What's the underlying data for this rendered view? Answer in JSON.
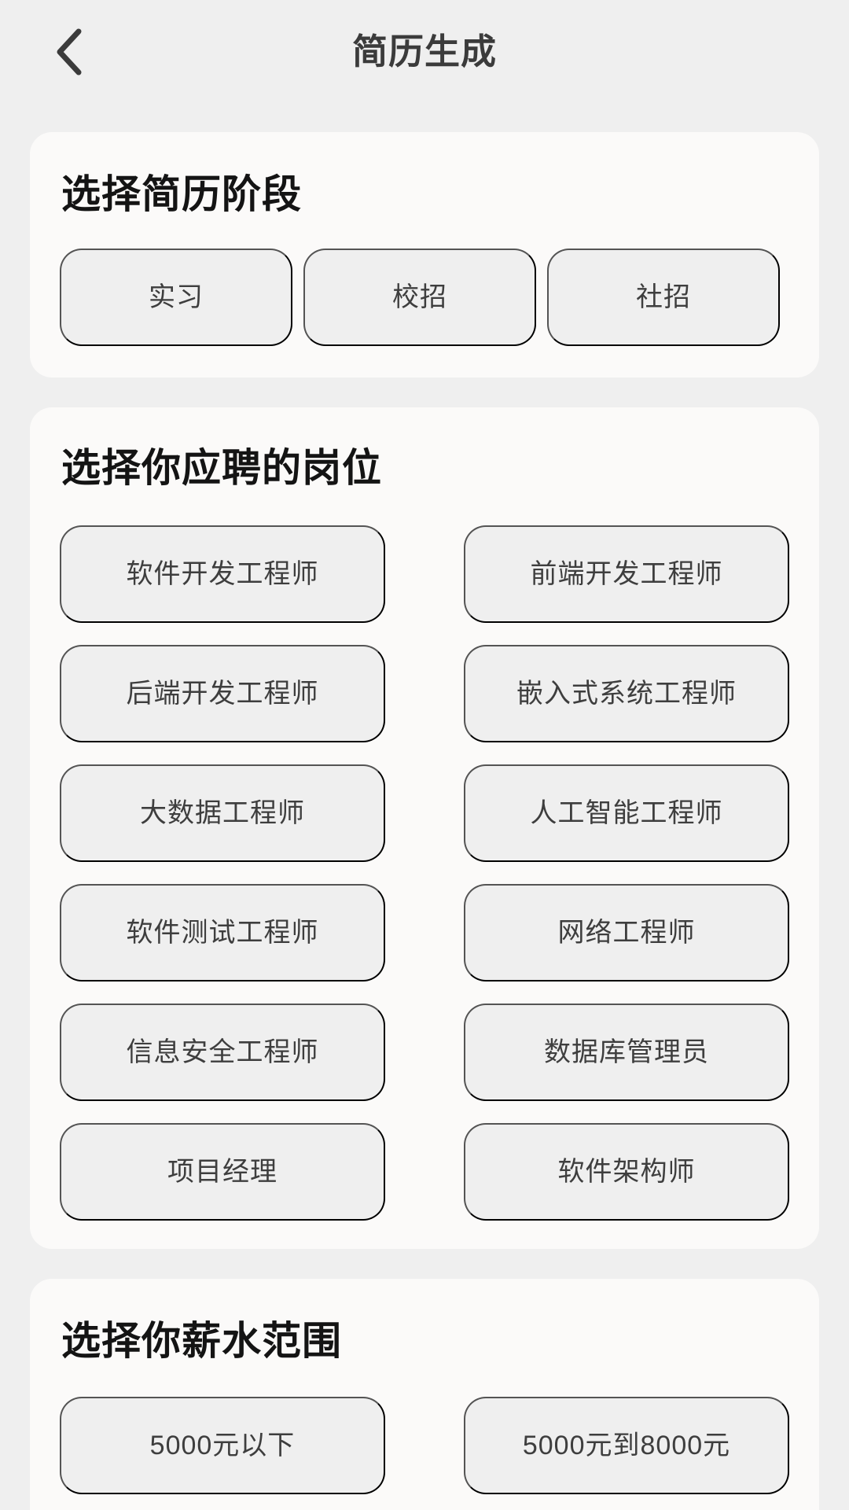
{
  "header": {
    "title": "简历生成",
    "back_icon": "chevron-left-icon"
  },
  "sections": {
    "stage": {
      "title": "选择简历阶段",
      "options": [
        "实习",
        "校招",
        "社招"
      ]
    },
    "position": {
      "title": "选择你应聘的岗位",
      "options": [
        "软件开发工程师",
        "前端开发工程师",
        "后端开发工程师",
        "嵌入式系统工程师",
        "大数据工程师",
        "人工智能工程师",
        "软件测试工程师",
        "网络工程师",
        "信息安全工程师",
        "数据库管理员",
        "项目经理",
        "软件架构师"
      ]
    },
    "salary": {
      "title": "选择你薪水范围",
      "options": [
        "5000元以下",
        "5000元到8000元"
      ]
    }
  },
  "colors": {
    "page_background": "#efefef",
    "card_background": "#fbfaf9",
    "option_background": "#efefef",
    "title_text": "#141414",
    "option_text": "#3e3e3e"
  }
}
